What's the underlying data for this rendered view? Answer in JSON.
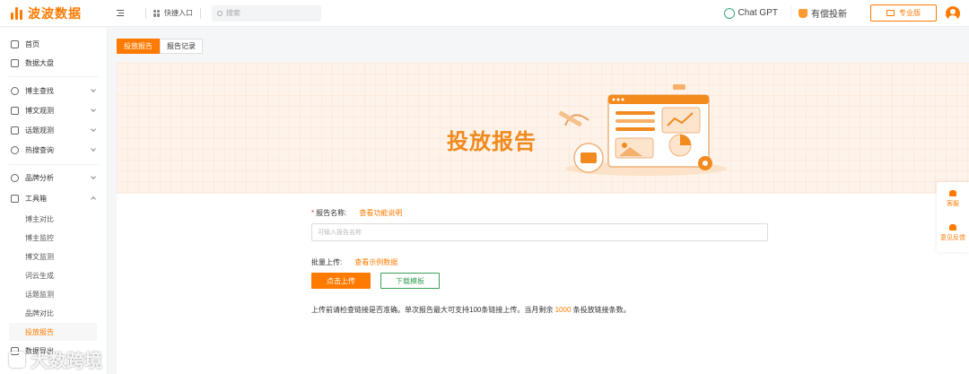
{
  "app": {
    "logo_text": "波波数据"
  },
  "header": {
    "quick_entry": "快捷入口",
    "search_placeholder": "搜索",
    "chatgpt": "Chat GPT",
    "youtou": "有偿投新",
    "pro_label": "专业版"
  },
  "sidebar": {
    "items": [
      {
        "label": "首页",
        "icon": "home-icon"
      },
      {
        "label": "数据大盘",
        "icon": "dashboard-icon"
      },
      {
        "label": "博主查找",
        "icon": "globe-icon"
      },
      {
        "label": "博文观测",
        "icon": "chart-icon"
      },
      {
        "label": "话题观测",
        "icon": "topic-icon"
      },
      {
        "label": "热搜查询",
        "icon": "fire-icon"
      },
      {
        "label": "品牌分析",
        "icon": "diamond-icon"
      },
      {
        "label": "工具箱",
        "icon": "toolbox-icon"
      }
    ],
    "sub_items": [
      "博主对比",
      "博主监控",
      "博文监测",
      "词云生成",
      "话题监测",
      "品牌对比",
      "投放报告"
    ],
    "partial_item": "数据导出"
  },
  "tabs": [
    "投放报告",
    "报告记录"
  ],
  "banner": {
    "title": "投放报告"
  },
  "form": {
    "name_label": "报告名称:",
    "name_required": "*",
    "name_link": "查看功能说明",
    "name_placeholder": "可输入报告名称",
    "upload_label": "批量上传:",
    "upload_link": "查看示例数据",
    "upload_button": "点击上传",
    "download_button": "下载模板",
    "note_prefix": "上传前请检查链接是否准确。单次报告最大可支持100条链接上传。当月剩余",
    "note_count": "1000",
    "note_suffix": "条投放链接条数。"
  },
  "float_panel": {
    "service": "客服",
    "feedback": "意见反馈"
  },
  "watermark": "大数跨境",
  "colors": {
    "accent": "#ff7a00",
    "success": "#3aa05a"
  }
}
